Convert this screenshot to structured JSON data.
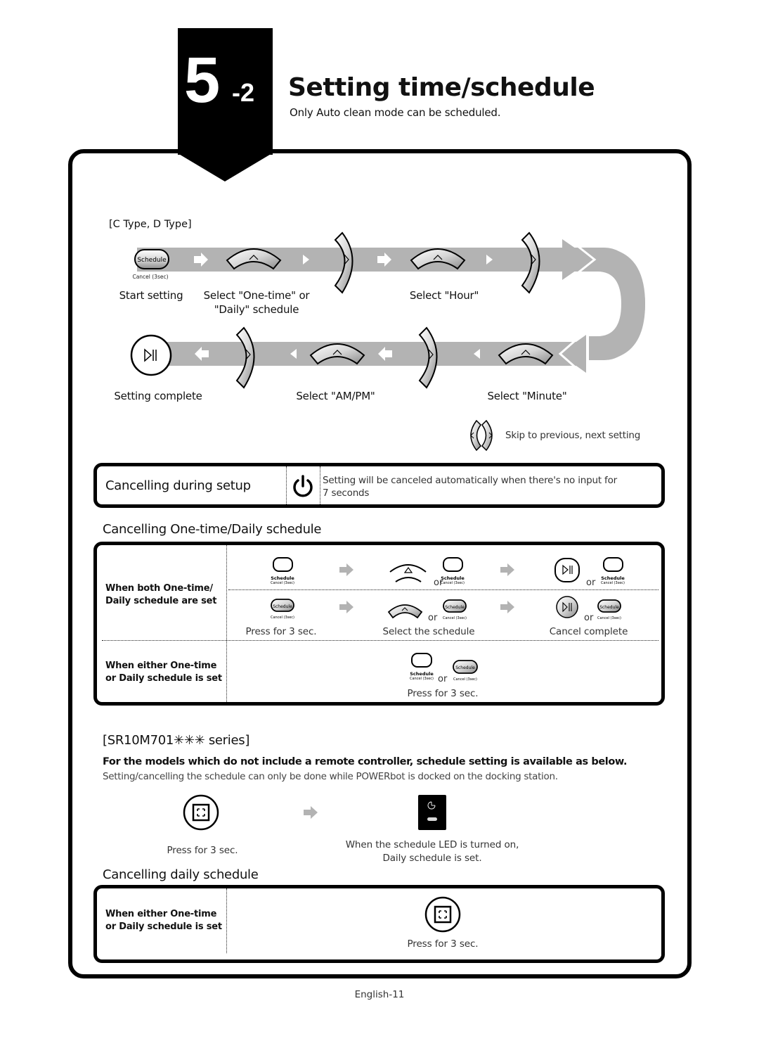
{
  "header": {
    "chapter_number": "5",
    "chapter_sub": "-2",
    "title": "Setting time/schedule",
    "subtitle": "Only Auto clean mode can be scheduled."
  },
  "flow": {
    "type_label": "[C Type, D Type]",
    "button_schedule_label": "Schedule",
    "button_cancel_label": "Cancel (3sec)",
    "steps_top": [
      {
        "label": "Start setting"
      },
      {
        "label": "Select \"One-time\" or"
      },
      {
        "label": "\"Daily\" schedule"
      },
      {
        "label": "Select \"Hour\""
      }
    ],
    "steps_bottom": [
      {
        "label": "Setting complete"
      },
      {
        "label": "Select \"AM/PM\""
      },
      {
        "label": "Select \"Minute\""
      }
    ],
    "skip_note": "Skip to previous, next setting",
    "colors": {
      "track": "#b3b3b3",
      "arrow": "#ffffff"
    }
  },
  "cancel_setup": {
    "title": "Cancelling during setup",
    "icon": "power-icon",
    "note_line1": "Setting will be canceled automatically when there's no input for",
    "note_line2": "7 seconds"
  },
  "cancel_schedule": {
    "title": "Cancelling One-time/Daily schedule",
    "row1_label_line1": "When both One-time/",
    "row1_label_line2": "Daily schedule are set",
    "row2_label_line1": "When either One-time",
    "row2_label_line2": "or Daily schedule is set",
    "or_text": "or",
    "captions": [
      "Press for 3 sec.",
      "Select the schedule",
      "Cancel complete"
    ],
    "row2_caption": "Press for 3 sec."
  },
  "series": {
    "title": "[SR10M701✳✳✳ series]",
    "note_bold": "For the models which do not include a remote controller, schedule setting is available as below.",
    "note_light": "Setting/cancelling the schedule can only be done while POWERbot is docked on the docking station.",
    "step1_caption": "Press for 3 sec.",
    "step2_caption_line1": "When the schedule LED is turned on,",
    "step2_caption_line2": "Daily schedule is set."
  },
  "cancel_daily": {
    "title": "Cancelling daily schedule",
    "label_line1": "When either One-time",
    "label_line2": "or Daily schedule is set",
    "caption": "Press for 3 sec."
  },
  "footer": {
    "page_number": "English-11"
  }
}
